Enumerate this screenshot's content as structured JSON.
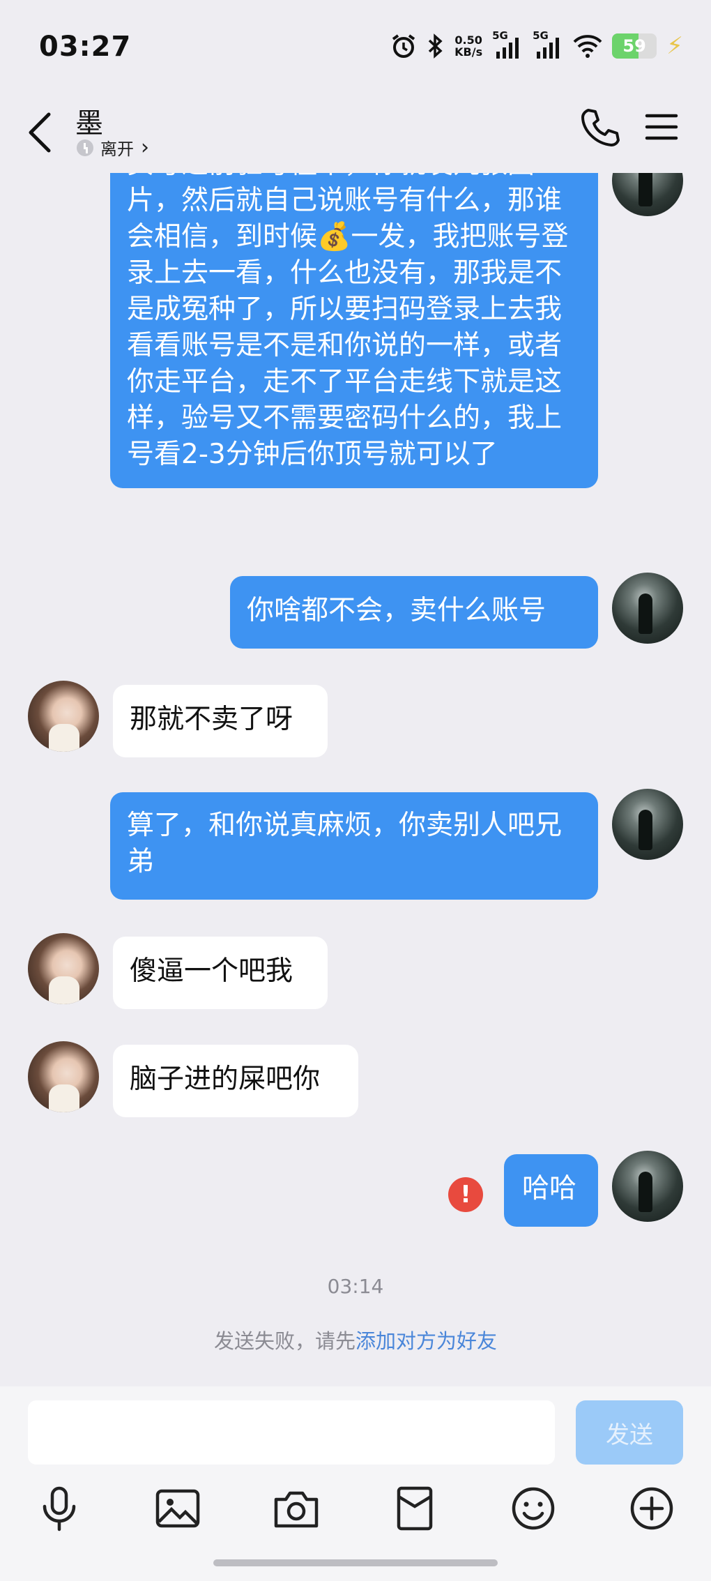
{
  "status_bar": {
    "time": "03:27",
    "net_speed_value": "0.50",
    "net_speed_unit": "KB/s",
    "signal_1": "5G",
    "signal_2": "5G",
    "battery": "59",
    "battery_level": 0.59,
    "icons": [
      "alarm-icon",
      "bluetooth-icon",
      "signal-icon",
      "signal-icon",
      "wifi-icon",
      "battery-icon",
      "charging-icon"
    ]
  },
  "header": {
    "contact_name": "墨",
    "presence": "离开",
    "presence_chevron": "›",
    "icons": [
      "back-icon",
      "clock-icon",
      "phone-icon",
      "menu-icon"
    ]
  },
  "messages": [
    {
      "from": "me",
      "text": "买号之前验号懂不，你就发几张图片，然后就自己说账号有什么，那谁会相信，到时候💰一发，我把账号登录上去一看，什么也没有，那我是不是成冤种了，所以要扫码登录上去我看看账号是不是和你说的一样，或者你走平台，走不了平台走线下就是这样，验号又不需要密码什么的，我上号看2-3分钟后你顶号就可以了"
    },
    {
      "from": "me",
      "text": "你啥都不会，卖什么账号"
    },
    {
      "from": "peer",
      "text": "那就不卖了呀"
    },
    {
      "from": "me",
      "text": "算了，和你说真麻烦，你卖别人吧兄弟"
    },
    {
      "from": "peer",
      "text": "傻逼一个吧我"
    },
    {
      "from": "peer",
      "text": "脑子进的屎吧你"
    },
    {
      "from": "me",
      "text": "哈哈",
      "failed": true,
      "failed_mark": "!"
    }
  ],
  "timestamp": "03:14",
  "system_note": {
    "prefix": "发送失败，请先",
    "link": "添加对方为好友"
  },
  "input": {
    "value": "",
    "placeholder": "",
    "send_label": "发送"
  },
  "toolbar": [
    "microphone-icon",
    "image-icon",
    "camera-icon",
    "red-packet-icon",
    "emoji-icon",
    "plus-icon"
  ],
  "colors": {
    "background": "#eeedf2",
    "outgoing_bubble": "#3e93f2",
    "incoming_bubble": "#ffffff",
    "error": "#e84a3e",
    "link": "#4a86d9",
    "send_disabled": "#9bcaf8"
  }
}
